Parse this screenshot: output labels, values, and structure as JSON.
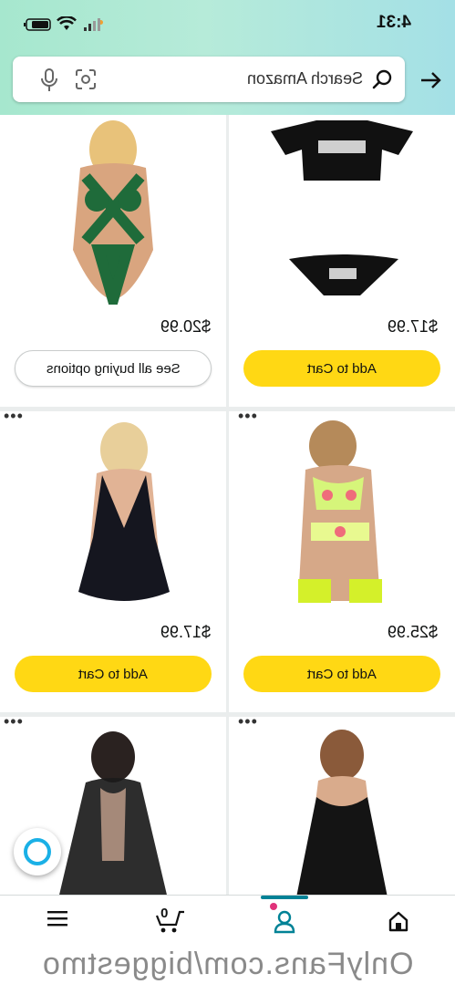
{
  "status_bar": {
    "time": "4:31"
  },
  "search": {
    "placeholder": "Search Amazon"
  },
  "products": [
    {
      "price": "$20.99",
      "button": "See all buying options",
      "button_type": "options",
      "image": "green-strappy-bodysuit"
    },
    {
      "price": "$17.99",
      "button": "Add to Cart",
      "button_type": "cart",
      "image": "black-crop-top-and-thong-set"
    },
    {
      "price": "$17.99",
      "button": "Add to Cart",
      "button_type": "cart",
      "image": "black-lace-babydoll"
    },
    {
      "price": "$25.99",
      "button": "Add to Cart",
      "button_type": "cart",
      "image": "neon-floral-lingerie-set"
    },
    {
      "price": "",
      "button": "",
      "button_type": "",
      "image": "black-lace-robe"
    },
    {
      "price": "",
      "button": "",
      "button_type": "",
      "image": "black-lace-slip-dress"
    }
  ],
  "more_glyph": "•••",
  "bottom_nav": {
    "cart_count": "0"
  },
  "watermark": "OnlyFans.com/biggestmo",
  "colors": {
    "cart_button": "#ffd814",
    "topbar_start": "#a6e7ce",
    "topbar_end": "#a4e0e6",
    "accent": "#008296",
    "badge": "#e0327a"
  }
}
